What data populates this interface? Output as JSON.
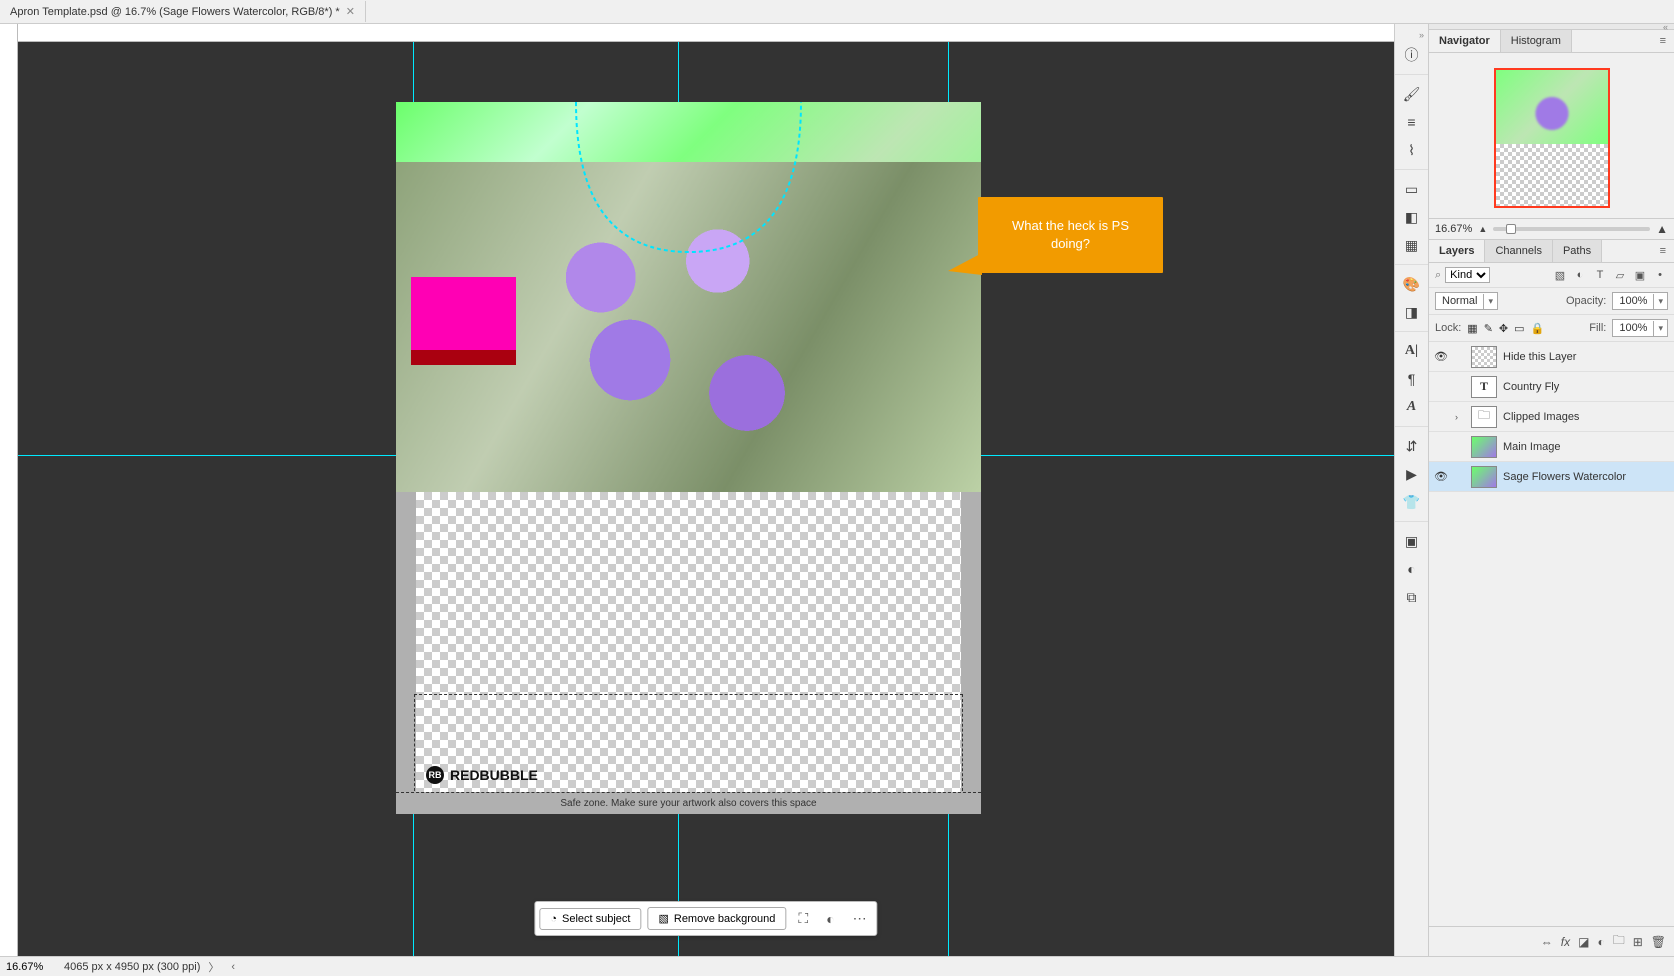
{
  "tab": {
    "title": "Apron Template.psd @ 16.7% (Sage Flowers Watercolor, RGB/8*) *",
    "close": "✕"
  },
  "canvas": {
    "safezone_text": "Safe zone. Make sure your artwork also covers this space",
    "brand_name": "REDBUBBLE",
    "brand_logo_glyph": "RB"
  },
  "callout": {
    "text": "What the heck is PS doing?"
  },
  "action_bar": {
    "select_subject": "Select subject",
    "remove_bg": "Remove background"
  },
  "dock_icons": [
    "info-icon",
    "brush-icon",
    "sliders-icon",
    "clone-stamp-icon",
    "crop-icon",
    "gradient-icon",
    "grid-icon",
    "color-icon",
    "swatches-icon",
    "text-a-icon",
    "para-icon",
    "type-style-icon",
    "layers-icon",
    "play-icon",
    "hanger-icon",
    "image-icon",
    "exposure-icon",
    "library-icon"
  ],
  "panels": {
    "navigator": {
      "tab": "Navigator",
      "alt_tab": "Histogram",
      "zoom": "16.67%"
    },
    "layers": {
      "tabs": {
        "layers": "Layers",
        "channels": "Channels",
        "paths": "Paths"
      },
      "kind_placeholder": "Kind",
      "blend": "Normal",
      "opacity_label": "Opacity:",
      "opacity": "100%",
      "lock_label": "Lock:",
      "fill_label": "Fill:",
      "fill": "100%",
      "mini_icons": [
        "image",
        "adj",
        "text",
        "shape",
        "smart",
        "dot"
      ],
      "lock_icons": [
        "grid",
        "brush",
        "move",
        "frame",
        "lock"
      ],
      "items": [
        {
          "visible": true,
          "thumb": "checker",
          "name": "Hide this Layer"
        },
        {
          "visible": false,
          "thumb": "T",
          "name": "Country Fly"
        },
        {
          "visible": false,
          "thumb": "folder",
          "name": "Clipped Images",
          "expandable": true
        },
        {
          "visible": false,
          "thumb": "img",
          "name": "Main Image"
        },
        {
          "visible": true,
          "thumb": "img",
          "name": "Sage Flowers Watercolor",
          "selected": true
        }
      ],
      "footer_icons": [
        "link",
        "fx",
        "mask",
        "adjust",
        "folder",
        "new",
        "trash"
      ]
    }
  },
  "status": {
    "zoom": "16.67%",
    "dims": "4065 px x 4950 px (300 ppi)"
  }
}
